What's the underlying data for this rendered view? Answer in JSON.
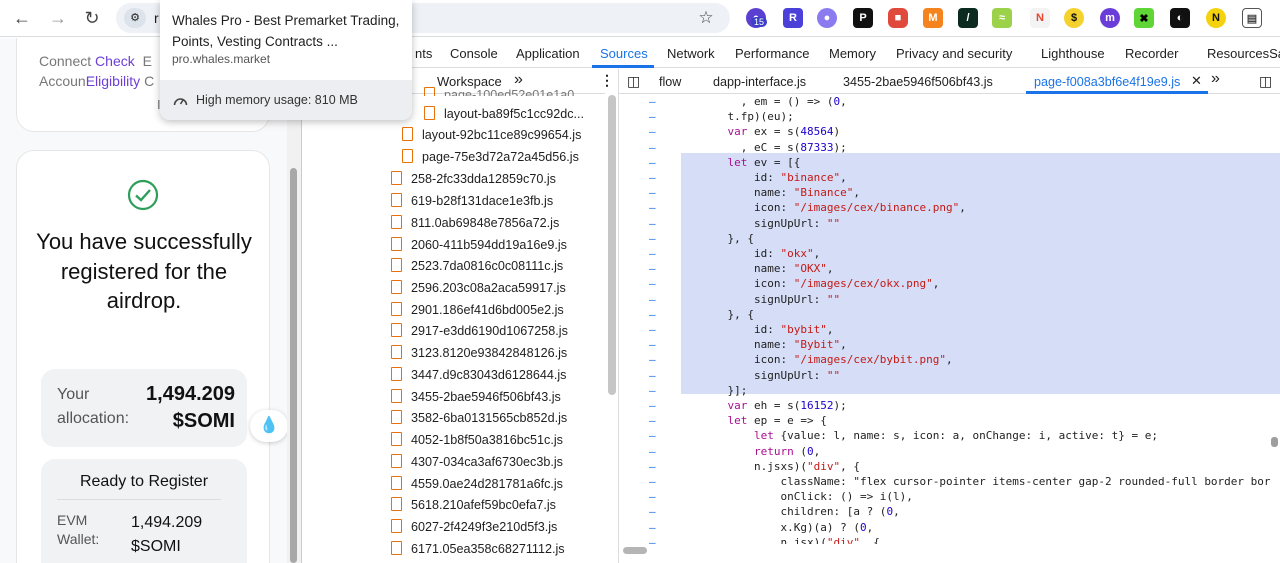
{
  "browser": {
    "url_fragment": "r",
    "extension_badge": "15",
    "extensions": [
      "ext-1",
      "ext-2",
      "ext-3",
      "ext-4",
      "ext-5",
      "ext-6",
      "ext-7",
      "ext-8",
      "ext-9",
      "ext-10",
      "ext-11",
      "ext-12",
      "ext-13",
      "ext-14"
    ]
  },
  "tab_tooltip": {
    "title": "Whales Pro - Best Premarket Trading, Points, Vesting Contracts ...",
    "url": "pro.whales.market",
    "memory": "High memory usage: 810 MB"
  },
  "page": {
    "top_links": {
      "connect": "Connect",
      "check": "Check",
      "account": "Accoun",
      "eligibility": "Eligibility",
      "frag1": "E",
      "frag2": "C",
      "frag3": "I"
    },
    "success_title": "You have successfully registered for the airdrop.",
    "allocation_label": "Your allocation:",
    "allocation_value": "1,494.209 $SOMI",
    "ready_title": "Ready to Register",
    "evm_label": "EVM Wallet:",
    "evm_value": "1,494.209 $SOMI"
  },
  "devtools": {
    "tabs": [
      "nts",
      "Console",
      "Application",
      "Sources",
      "Network",
      "Performance",
      "Memory",
      "Privacy and security",
      "Lighthouse",
      "Recorder",
      "ResourcesSa"
    ],
    "active_tab": "Sources",
    "nav": {
      "workspace": "Workspace",
      "more": "»"
    },
    "editor_tabs": [
      "flow",
      "dapp-interface.js",
      "3455-2bae5946f506bf43.js",
      "page-f008a3bf6e4f19e9.js"
    ],
    "files": [
      "page-100ed52e01e1a0...",
      "layout-ba89f5c1cc92dc...",
      "layout-92bc11ce89c99654.js",
      "page-75e3d72a72a45d56.js",
      "258-2fc33dda12859c70.js",
      "619-b28f131dace1e3fb.js",
      "811.0ab69848e7856a72.js",
      "2060-411b594dd19a16e9.js",
      "2523.7da0816c0c08111c.js",
      "2596.203c08a2aca59917.js",
      "2901.186ef41d6bd005e2.js",
      "2917-e3dd6190d1067258.js",
      "3123.8120e93842848126.js",
      "3447.d9c83043d6128644.js",
      "3455-2bae5946f506bf43.js",
      "3582-6ba0131565cb852d.js",
      "4052-1b8f50a3816bc51c.js",
      "4307-034ca3af6730ec3b.js",
      "4559.0ae24d281781a6fc.js",
      "5618.210afef59bc0efa7.js",
      "6027-2f4249f3e210d5f3.js",
      "6171.05ea358c68271112.js"
    ],
    "code_lines": [
      "      , em = () => (0,",
      "    t.fp)(eu);",
      "    var ex = s(48564)",
      "      , eC = s(87333);",
      "    let ev = [{",
      "        id: \"binance\",",
      "        name: \"Binance\",",
      "        icon: \"/images/cex/binance.png\",",
      "        signUpUrl: \"\"",
      "    }, {",
      "        id: \"okx\",",
      "        name: \"OKX\",",
      "        icon: \"/images/cex/okx.png\",",
      "        signUpUrl: \"\"",
      "    }, {",
      "        id: \"bybit\",",
      "        name: \"Bybit\",",
      "        icon: \"/images/cex/bybit.png\",",
      "        signUpUrl: \"\"",
      "    }];",
      "    var eh = s(16152);",
      "    let ep = e => {",
      "        let {value: l, name: s, icon: a, onChange: i, active: t} = e;",
      "        return (0,",
      "        n.jsxs)(\"div\", {",
      "            className: \"flex cursor-pointer items-center gap-2 rounded-full border bor",
      "            onClick: () => i(l),",
      "            children: [a ? (0,",
      "            x.Kg)(a) ? (0,",
      "            n.jsx)(\"div\", {"
    ],
    "gutter_mark": "–",
    "colors": {
      "accent": "#1a73e8",
      "highlight": "#d5ddf7",
      "check_green": "#2e9e5b",
      "link_purple": "#6d3fd6"
    }
  }
}
